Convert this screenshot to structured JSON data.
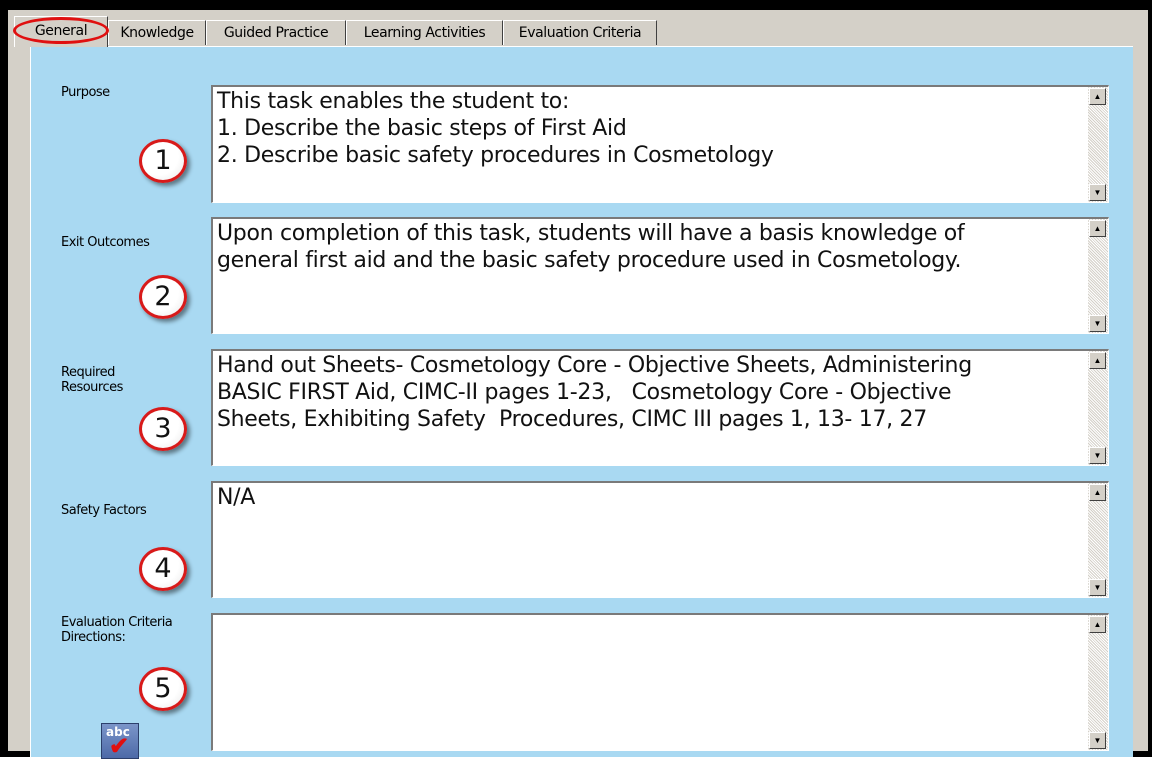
{
  "tabs": [
    {
      "label": "General",
      "active": true
    },
    {
      "label": "Knowledge",
      "active": false
    },
    {
      "label": "Guided Practice",
      "active": false
    },
    {
      "label": "Learning Activities",
      "active": false
    },
    {
      "label": "Evaluation Criteria",
      "active": false
    }
  ],
  "fields": [
    {
      "label": "Purpose",
      "badge": "1",
      "value": "This task enables the student to:\n1. Describe the basic steps of First Aid\n2. Describe basic safety procedures in Cosmetology"
    },
    {
      "label": "Exit Outcomes",
      "badge": "2",
      "value": "Upon completion of this task, students will have a basis knowledge of\ngeneral first aid and the basic safety procedure used in Cosmetology."
    },
    {
      "label": "Required\nResources",
      "badge": "3",
      "value": "Hand out Sheets- Cosmetology Core - Objective Sheets, Administering\nBASIC FIRST Aid, CIMC-II pages 1-23,   Cosmetology Core - Objective\nSheets, Exhibiting Safety  Procedures, CIMC III pages 1, 13- 17, 27"
    },
    {
      "label": "Safety Factors",
      "badge": "4",
      "value": "N/A"
    },
    {
      "label": "Evaluation Criteria\nDirections:",
      "badge": "5",
      "value": ""
    }
  ],
  "spell_check": {
    "text": "abc",
    "icon": "spell-check-icon"
  },
  "colors": {
    "panel_background": "#a9d9f2",
    "window_background": "#d4d0c8",
    "annotation_red": "#e01010"
  }
}
